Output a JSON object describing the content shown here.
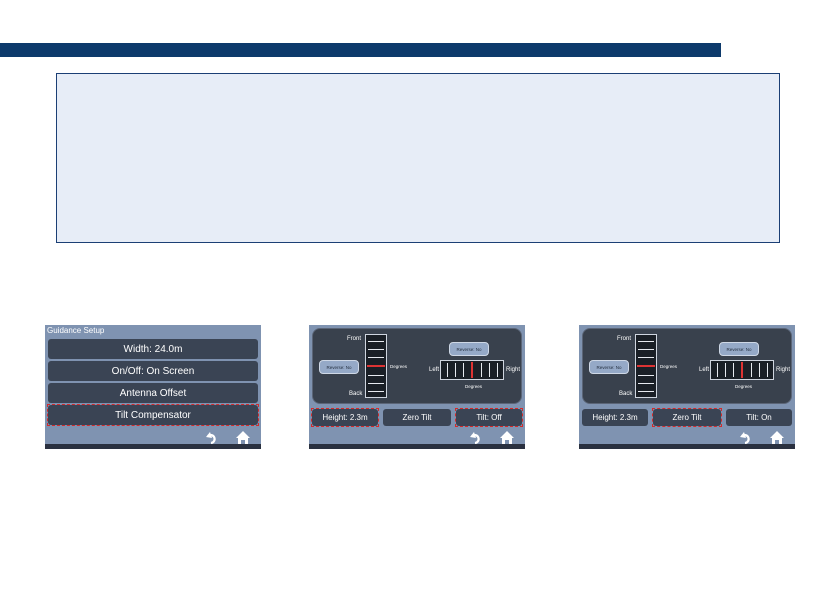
{
  "screens": {
    "one": {
      "title": "Guidance Setup",
      "buttons": [
        "Width: 24.0m",
        "On/Off: On Screen",
        "Antenna Offset",
        "Tilt Compensator"
      ]
    },
    "two": {
      "front": "Front",
      "back": "Back",
      "degrees": "Degrees",
      "left": "Left",
      "right": "Right",
      "reverse1": "Reverse: No",
      "reverse2": "Reverse: No",
      "height": "Height: 2.3m",
      "zero": "Zero Tilt",
      "tilt": "Tilt: Off"
    },
    "three": {
      "front": "Front",
      "back": "Back",
      "degrees": "Degrees",
      "left": "Left",
      "right": "Right",
      "reverse1": "Reverse: No",
      "reverse2": "Reverse: No",
      "height": "Height: 2.3m",
      "zero": "Zero Tilt",
      "tilt": "Tilt: On"
    }
  },
  "icons": [
    "back-arrow-icon",
    "home-icon"
  ],
  "colors": {
    "banner": "#0d3a6b",
    "note_bg": "#e7edf7",
    "screen_bg": "#7f93b1",
    "highlight": "#d42a2a"
  }
}
